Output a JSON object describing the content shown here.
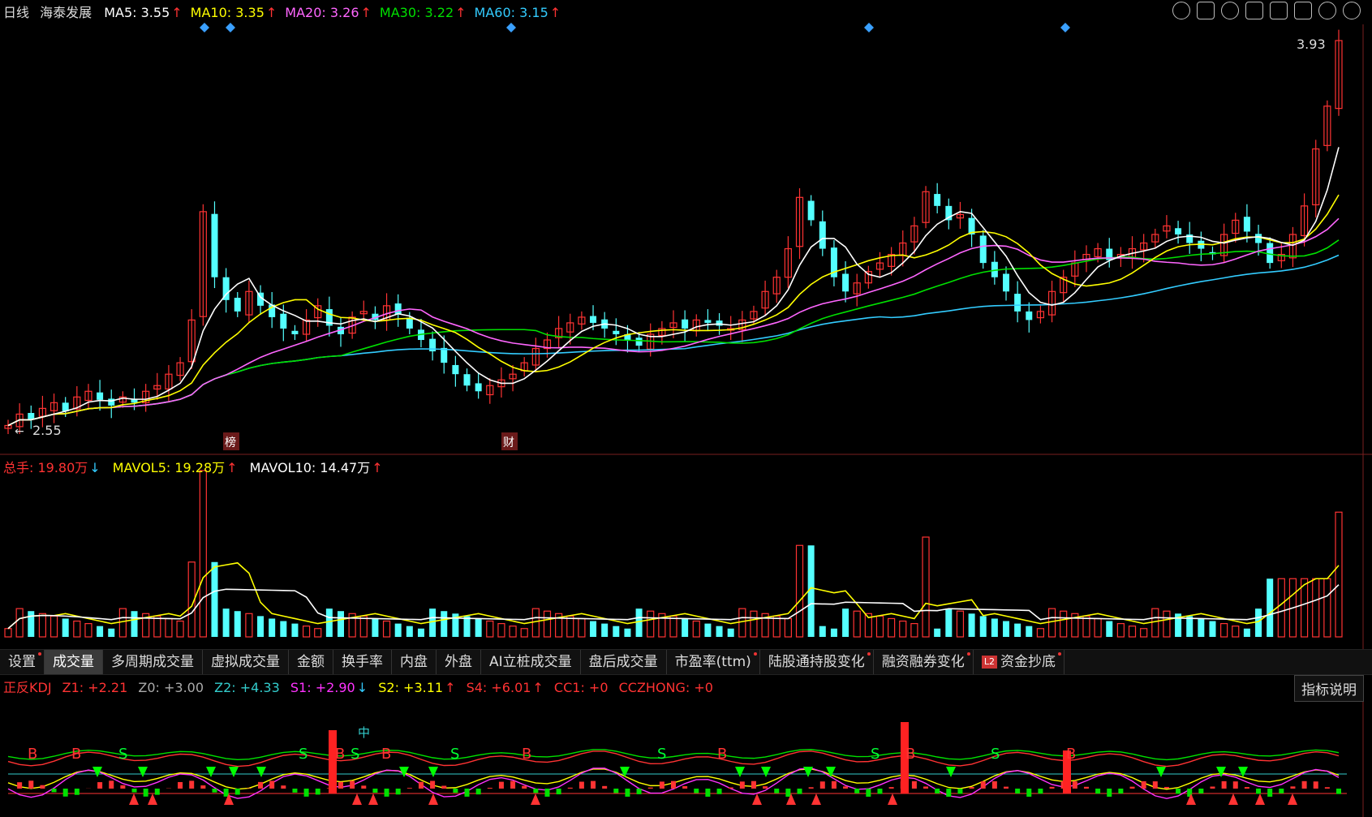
{
  "header": {
    "period": "日线",
    "stock_name": "海泰发展",
    "ma": [
      {
        "label": "MA5: 3.55",
        "arrow": "↑",
        "color": "#ffffff"
      },
      {
        "label": "MA10: 3.35",
        "arrow": "↑",
        "color": "#ffff00"
      },
      {
        "label": "MA20: 3.26",
        "arrow": "↑",
        "color": "#ff66ff"
      },
      {
        "label": "MA30: 3.22",
        "arrow": "↑",
        "color": "#00e000"
      },
      {
        "label": "MA60: 3.15",
        "arrow": "↑",
        "color": "#33ccff"
      }
    ]
  },
  "price_panel": {
    "high_label": "3.93",
    "low_label": "2.55",
    "markers": [
      "榜",
      "财"
    ]
  },
  "volume_header": {
    "total": "总手: 19.80万",
    "total_arrow": "↓",
    "mavol5": "MAVOL5: 19.28万",
    "mavol5_arrow": "↑",
    "mavol10": "MAVOL10: 14.47万",
    "mavol10_arrow": "↑"
  },
  "tabs": [
    {
      "label": "设置",
      "dot": true
    },
    {
      "label": "成交量",
      "dot": false,
      "active": true
    },
    {
      "label": "多周期成交量",
      "dot": false
    },
    {
      "label": "虚拟成交量",
      "dot": false
    },
    {
      "label": "金额",
      "dot": false
    },
    {
      "label": "换手率",
      "dot": false
    },
    {
      "label": "内盘",
      "dot": false
    },
    {
      "label": "外盘",
      "dot": false
    },
    {
      "label": "AI立桩成交量",
      "dot": false
    },
    {
      "label": "盘后成交量",
      "dot": false
    },
    {
      "label": "市盈率(ttm)",
      "dot": true
    },
    {
      "label": "陆股通持股变化",
      "dot": true
    },
    {
      "label": "融资融券变化",
      "dot": true
    },
    {
      "label": "资金抄底",
      "dot": true,
      "badge": "L2"
    }
  ],
  "indicator_header": {
    "name": "正反KDJ",
    "z1": "Z1: +2.21",
    "z0": "Z0: +3.00",
    "z2": "Z2: +4.33",
    "s1": "S1: +2.90",
    "s1_arrow": "↓",
    "s2": "S2: +3.11",
    "s2_arrow": "↑",
    "s4": "S4: +6.01",
    "s4_arrow": "↑",
    "cc1": "CC1: +0",
    "cczhong": "CCZHONG: +0"
  },
  "explain_button": "指标说明",
  "signals": {
    "buy": "B",
    "sell": "S",
    "mid": "中"
  },
  "chart_data": {
    "type": "candlestick",
    "price_range": [
      2.55,
      3.93
    ],
    "closes": [
      2.58,
      2.62,
      2.6,
      2.64,
      2.66,
      2.63,
      2.68,
      2.7,
      2.67,
      2.65,
      2.68,
      2.66,
      2.7,
      2.72,
      2.76,
      2.8,
      2.95,
      3.33,
      3.1,
      3.02,
      2.98,
      3.05,
      3.0,
      2.96,
      2.92,
      2.9,
      2.95,
      3.0,
      2.93,
      2.9,
      2.96,
      2.98,
      2.95,
      3.0,
      2.97,
      2.92,
      2.88,
      2.84,
      2.8,
      2.76,
      2.72,
      2.7,
      2.72,
      2.74,
      2.76,
      2.8,
      2.85,
      2.88,
      2.92,
      2.94,
      2.96,
      2.94,
      2.92,
      2.9,
      2.88,
      2.86,
      2.9,
      2.92,
      2.94,
      2.92,
      2.95,
      2.94,
      2.93,
      2.92,
      2.95,
      2.98,
      3.05,
      3.1,
      3.2,
      3.38,
      3.3,
      3.2,
      3.1,
      3.05,
      3.08,
      3.12,
      3.15,
      3.18,
      3.22,
      3.28,
      3.4,
      3.35,
      3.3,
      3.32,
      3.25,
      3.15,
      3.1,
      3.05,
      2.98,
      2.95,
      2.98,
      3.05,
      3.1,
      3.15,
      3.18,
      3.2,
      3.16,
      3.18,
      3.2,
      3.22,
      3.25,
      3.28,
      3.25,
      3.22,
      3.2,
      3.18,
      3.25,
      3.3,
      3.26,
      3.22,
      3.15,
      3.18,
      3.25,
      3.35,
      3.55,
      3.7,
      3.93
    ],
    "volume_peak_label": "",
    "ma_labels": [
      "MA5",
      "MA10",
      "MA20",
      "MA30",
      "MA60"
    ]
  }
}
